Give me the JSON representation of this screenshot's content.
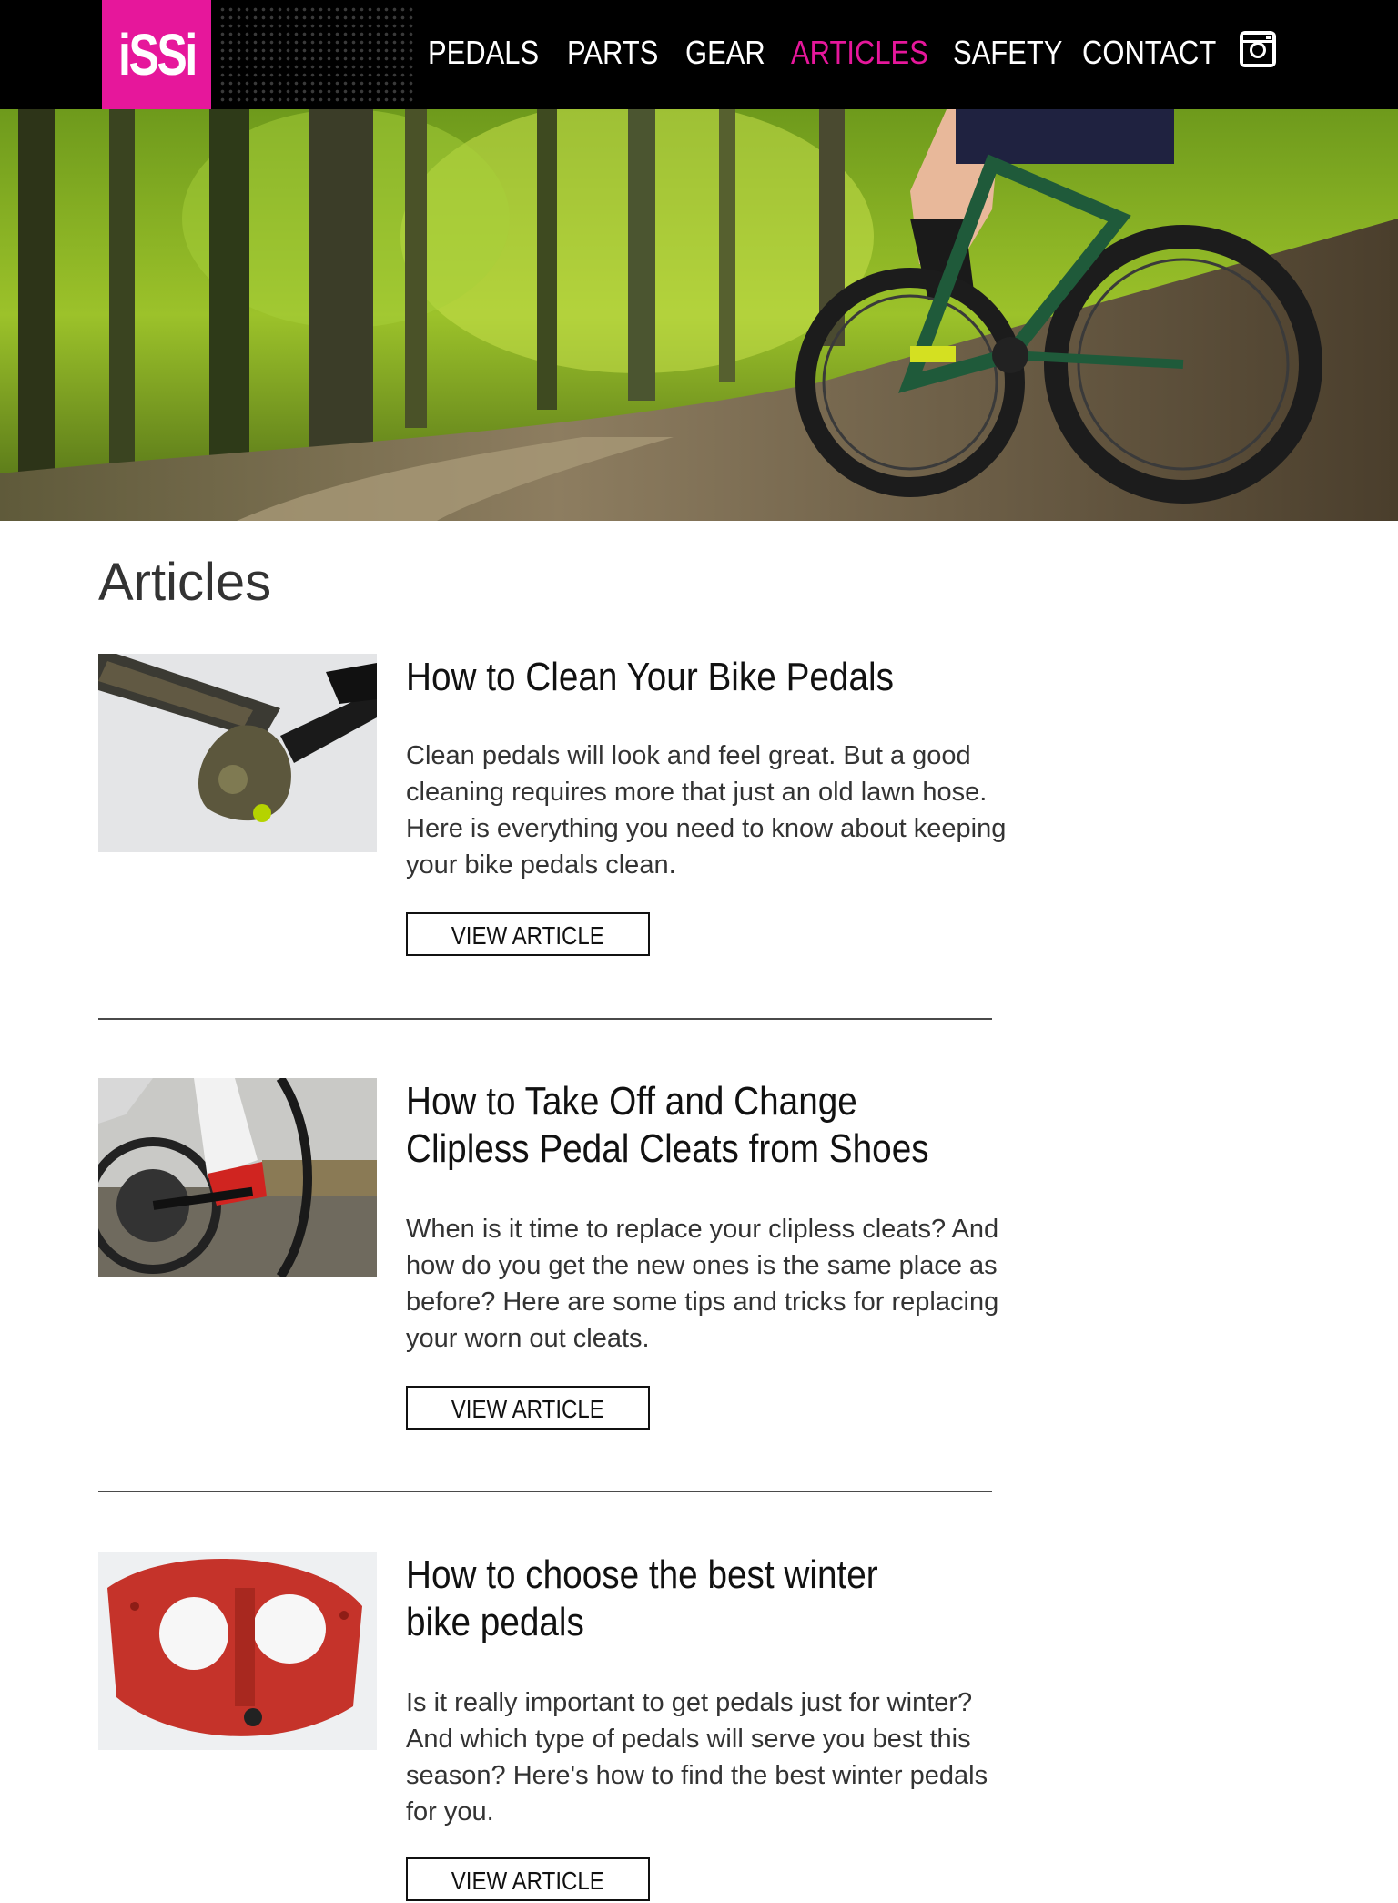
{
  "header": {
    "logo_text": "iSSi",
    "brand_color": "#e6179b",
    "nav": [
      {
        "label": "PEDALS",
        "active": false
      },
      {
        "label": "PARTS",
        "active": false
      },
      {
        "label": "GEAR",
        "active": false
      },
      {
        "label": "ARTICLES",
        "active": true
      },
      {
        "label": "SAFETY",
        "active": false
      },
      {
        "label": "CONTACT",
        "active": false
      }
    ],
    "social_icon": "instagram-icon"
  },
  "page": {
    "title": "Articles"
  },
  "articles": [
    {
      "title": "How to Clean Your Bike Pedals",
      "description": "Clean pedals will look and feel great. But a good cleaning requires more that just an old lawn hose. Here is everything you need to know about keeping your bike pedals clean.",
      "button_label": "VIEW ARTICLE"
    },
    {
      "title": "How to Take Off and Change Clipless Pedal Cleats from Shoes",
      "description": "When is it time to replace your clipless cleats? And how do you get the new ones is the same place as before? Here are some tips and tricks for replacing your worn out cleats.",
      "button_label": "VIEW ARTICLE"
    },
    {
      "title": "How to choose the best winter bike pedals",
      "description": "Is it really important to get pedals just for winter? And which type of pedals will serve you best this season? Here's how to find the best winter pedals for you.",
      "button_label": "VIEW ARTICLE"
    }
  ]
}
